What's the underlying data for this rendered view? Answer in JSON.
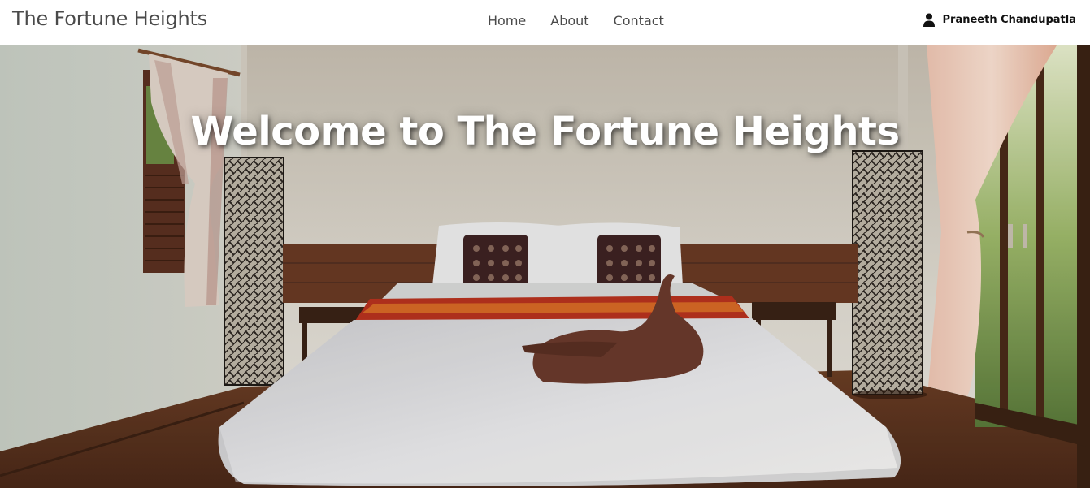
{
  "navbar": {
    "brand": "The Fortune Heights",
    "links": [
      "Home",
      "About",
      "Contact"
    ],
    "user_name": "Praneeth Chandupatla",
    "user_icon": "person-icon"
  },
  "hero": {
    "title": "Welcome to The Fortune Heights",
    "image": "hotel-bedroom-photo"
  }
}
